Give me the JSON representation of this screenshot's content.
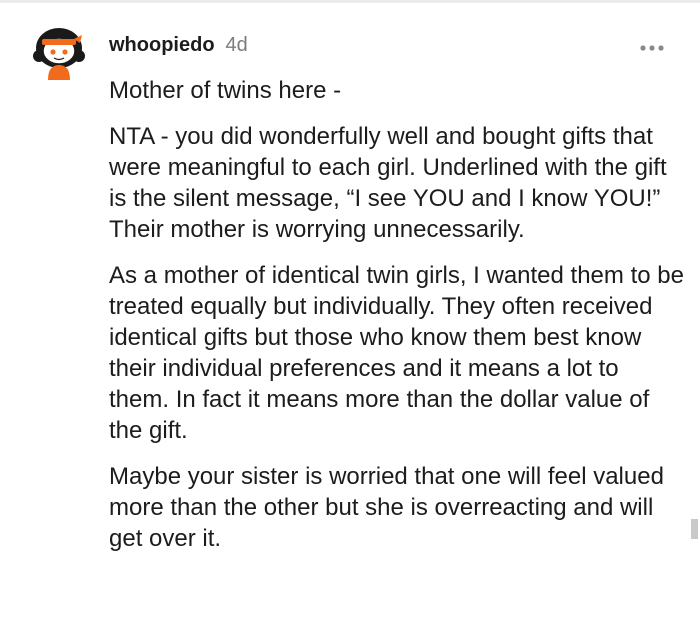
{
  "comment": {
    "author": "whoopiedo",
    "age": "4d",
    "avatar_icon": "snoo-avatar-orange-headband-icon",
    "more_icon": "more-options-icon",
    "paragraphs": [
      "Mother of twins here -",
      "NTA - you did wonderfully well and bought gifts that were meaningful to each girl. Underlined with the gift is the silent message, “I see YOU and I know YOU!” Their mother is worrying unnecessarily.",
      "As a mother of identical twin girls, I wanted them to be treated equally but individually. They often received identical gifts but those who know them best know their individual preferences and it means a lot to them. In fact it means more than the dollar value of the gift.",
      "Maybe your sister is worried that one will feel valued more than the other but she is overreacting and will get over it."
    ]
  },
  "colors": {
    "background": "#ffffff",
    "text": "#1c1c1c",
    "muted": "#7c7c7c",
    "avatar_orange": "#f26b1d"
  }
}
